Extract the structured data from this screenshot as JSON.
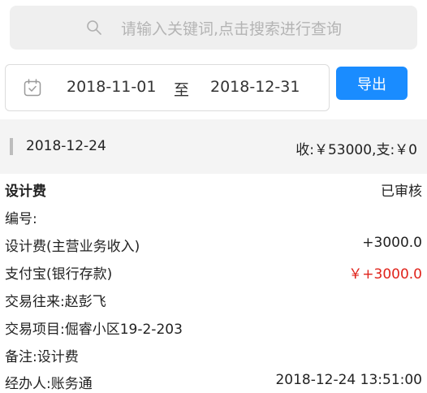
{
  "search": {
    "placeholder": "请输入关键词,点击搜索进行查询"
  },
  "filter": {
    "start_date": "2018-11-01",
    "to_label": "至",
    "end_date": "2018-12-31",
    "export_label": "导出"
  },
  "day_group": {
    "date": "2018-12-24",
    "summary": "收:￥53000,支:￥0"
  },
  "record": {
    "title": "设计费",
    "status": "已审核",
    "number_label": "编号:",
    "income_account": "设计费(主营业务收入)",
    "income_amount": "+3000.0",
    "payment_account": "支付宝(银行存款)",
    "payment_amount": "￥+3000.0",
    "counterparty": "交易往来:赵彭飞",
    "project": "交易项目:倔睿小区19-2-203",
    "note": "备注:设计费",
    "handler": "经办人:账务通",
    "timestamp": "2018-12-24 13:51:00"
  },
  "colors": {
    "accent": "#1a8cff",
    "negative": "#e0231b"
  }
}
